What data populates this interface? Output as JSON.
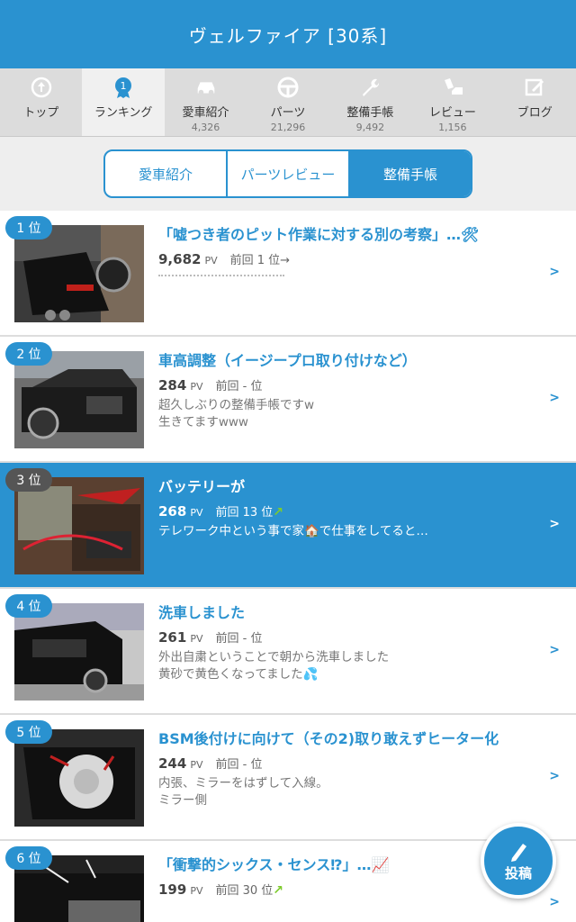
{
  "header": {
    "title": "ヴェルファイア [30系]"
  },
  "nav": [
    {
      "label": "トップ",
      "count": "",
      "icon": "home-up-icon"
    },
    {
      "label": "ランキング",
      "count": "",
      "icon": "ranking-medal-icon",
      "active": true
    },
    {
      "label": "愛車紹介",
      "count": "4,326",
      "icon": "car-icon"
    },
    {
      "label": "パーツ",
      "count": "21,296",
      "icon": "steering-wheel-icon"
    },
    {
      "label": "整備手帳",
      "count": "9,492",
      "icon": "wrench-icon"
    },
    {
      "label": "レビュー",
      "count": "1,156",
      "icon": "review-icon"
    },
    {
      "label": "ブログ",
      "count": "",
      "icon": "blog-pen-icon"
    }
  ],
  "segments": {
    "items": [
      "愛車紹介",
      "パーツレビュー",
      "整備手帳"
    ],
    "active": 2
  },
  "ranking": [
    {
      "rank": "1 位",
      "title": "「嘘つき者のピット作業に対する別の考察」…🛠",
      "pv": "9,682",
      "pv_unit": "PV",
      "prev": "前回 1 位",
      "trend": "→",
      "desc1": "",
      "desc2": "",
      "highlight": false
    },
    {
      "rank": "2 位",
      "title": "車高調整（イージープロ取り付けなど）",
      "pv": "284",
      "pv_unit": "PV",
      "prev": "前回 - 位",
      "trend": "",
      "desc1": "超久しぶりの整備手帳ですw",
      "desc2": "生きてますwww",
      "highlight": false
    },
    {
      "rank": "3 位",
      "title": "バッテリーが",
      "pv": "268",
      "pv_unit": "PV",
      "prev": "前回 13 位",
      "trend": "↗",
      "desc1": "テレワーク中という事で家🏠で仕事をしてると…",
      "desc2": "",
      "highlight": true
    },
    {
      "rank": "4 位",
      "title": "洗車しました",
      "pv": "261",
      "pv_unit": "PV",
      "prev": "前回 - 位",
      "trend": "",
      "desc1": "外出自粛ということで朝から洗車しました",
      "desc2": "黄砂で黄色くなってました💦",
      "highlight": false
    },
    {
      "rank": "5 位",
      "title": "BSM後付けに向けて（その2)取り敢えずヒーター化",
      "pv": "244",
      "pv_unit": "PV",
      "prev": "前回 - 位",
      "trend": "",
      "desc1": "内張、ミラーをはずして入線。",
      "desc2": "ミラー側",
      "highlight": false
    },
    {
      "rank": "6 位",
      "title": "「衝撃的シックス・センス⁉」…📈",
      "pv": "199",
      "pv_unit": "PV",
      "prev": "前回 30 位",
      "trend": "↗",
      "desc1": "",
      "desc2": "",
      "highlight": false
    }
  ],
  "fab": {
    "label": "投稿"
  },
  "chevron": ">"
}
